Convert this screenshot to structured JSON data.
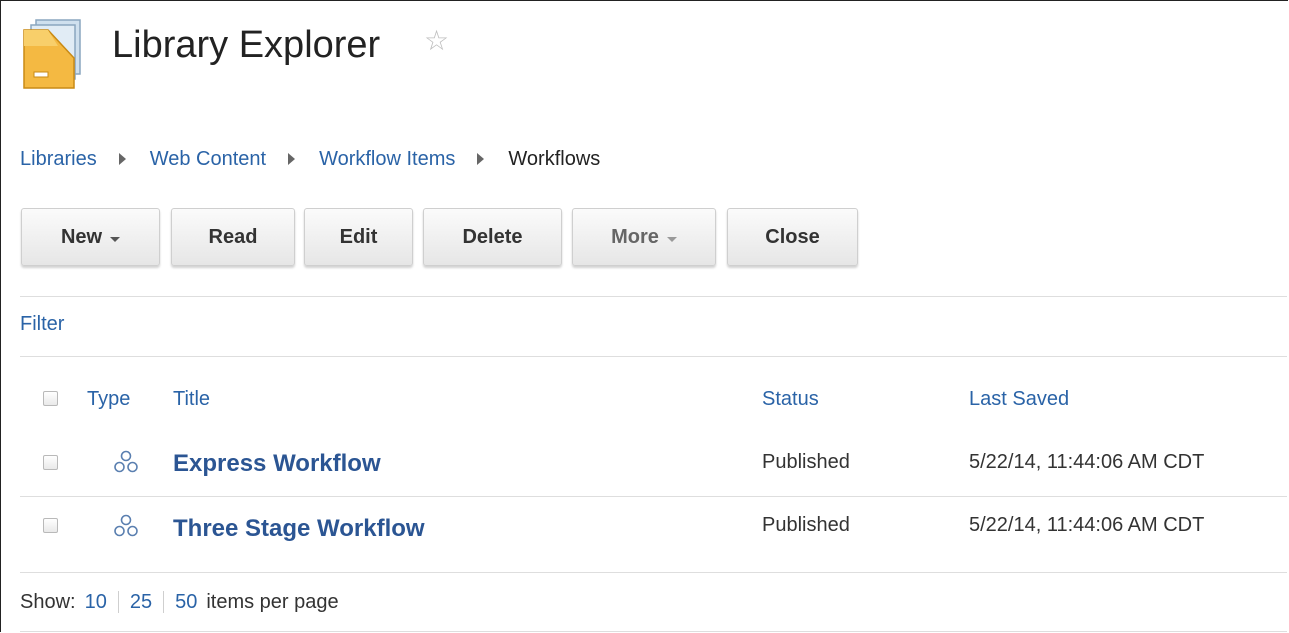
{
  "header": {
    "title": "Library Explorer",
    "app_icon": "library-folder-icon",
    "favorite_icon": "star-outline-icon"
  },
  "breadcrumb": {
    "items": [
      "Libraries",
      "Web Content",
      "Workflow Items"
    ],
    "current": "Workflows"
  },
  "toolbar": {
    "new_label": "New",
    "read_label": "Read",
    "edit_label": "Edit",
    "delete_label": "Delete",
    "more_label": "More",
    "close_label": "Close"
  },
  "filter": {
    "label": "Filter"
  },
  "table": {
    "columns": {
      "type": "Type",
      "title": "Title",
      "status": "Status",
      "last_saved": "Last Saved"
    },
    "rows": [
      {
        "icon": "workflow-icon",
        "title": "Express Workflow",
        "status": "Published",
        "last_saved": "5/22/14, 11:44:06 AM CDT"
      },
      {
        "icon": "workflow-icon",
        "title": "Three Stage Workflow",
        "status": "Published",
        "last_saved": "5/22/14, 11:44:06 AM CDT"
      }
    ]
  },
  "pager": {
    "show_label": "Show:",
    "options": [
      "10",
      "25",
      "50"
    ],
    "suffix": "items per page"
  },
  "colors": {
    "link": "#2a63a7",
    "title_link": "#2b5593",
    "text": "#222222"
  }
}
